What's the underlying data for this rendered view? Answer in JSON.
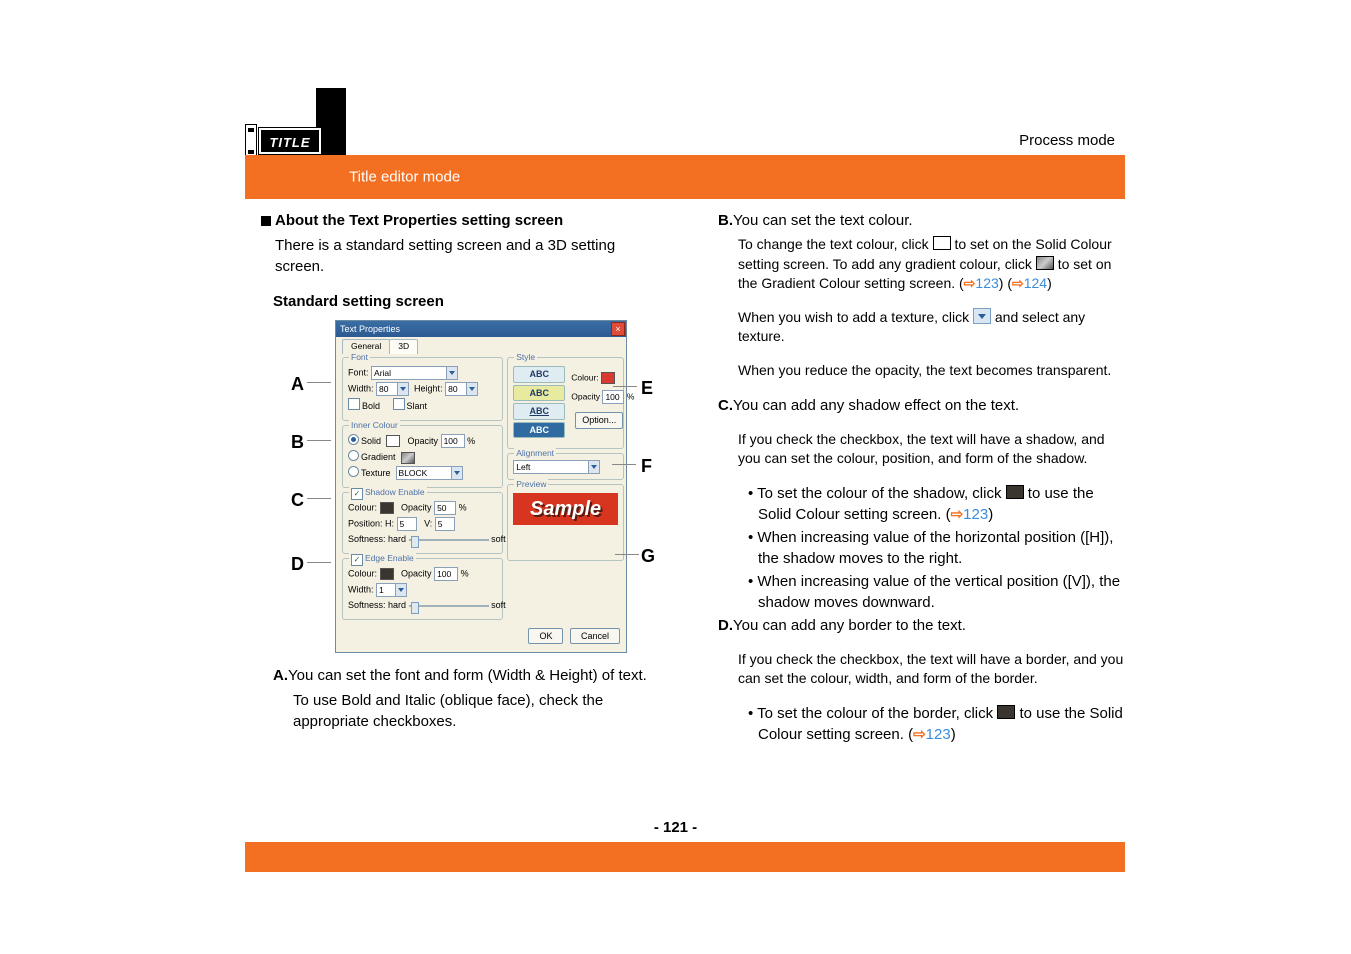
{
  "header": {
    "mode": "Title editor mode",
    "breadcrumb": "Process mode",
    "badge": "TITLE"
  },
  "left": {
    "heading": "About the Text Properties setting screen",
    "intro": "There is a standard setting screen and a 3D setting screen.",
    "subhead": "Standard setting screen",
    "callouts": {
      "a": "A",
      "b": "B",
      "c": "C",
      "d": "D",
      "e": "E",
      "f": "F",
      "g": "G"
    },
    "dialog": {
      "title": "Text Properties",
      "tabs": {
        "general": "General",
        "three_d": "3D"
      },
      "groups": {
        "font": "Font",
        "inner": "Inner Colour",
        "shadow": "Shadow Enable",
        "edge": "Edge Enable",
        "style": "Style",
        "alignment": "Alignment",
        "preview": "Preview"
      },
      "labels": {
        "font": "Font:",
        "width": "Width:",
        "height": "Height:",
        "bold": "Bold",
        "slant": "Slant",
        "solid": "Solid",
        "gradient": "Gradient",
        "texture": "Texture",
        "opacity": "Opacity",
        "colour": "Colour:",
        "position": "Position: H:",
        "v": "V:",
        "softness": "Softness: hard",
        "soft_end": "soft",
        "width2": "Width:",
        "option": "Option..."
      },
      "values": {
        "font_name": "Arial",
        "width": "80",
        "height": "80",
        "opacity": "100",
        "opacity_pct": "%",
        "shadow_opacity": "50",
        "pos_h": "5",
        "pos_v": "5",
        "edge_opacity": "100",
        "edge_width": "1",
        "texture_name": "BLOCK",
        "align": "Left",
        "style_abc": "ABC",
        "style_opacity": "100",
        "sample": "Sample"
      },
      "buttons": {
        "ok": "OK",
        "cancel": "Cancel"
      }
    },
    "items": {
      "a_pre": "A.",
      "a_text": "You can set the font and form (Width & Height) of text.",
      "a_sub": "To use Bold and Italic (oblique face), check the appropriate checkboxes."
    }
  },
  "right": {
    "items": {
      "b_pre": "B.",
      "b_text": "You can set the text colour.",
      "b_line1a": "To change the text colour, click ",
      "b_line1b": " to set on the Solid Colour setting screen. To add any gradient colour, click ",
      "b_line1c": " to set on the Gradient Colour setting screen. (",
      "b_link1": "123",
      "b_mid": ") (",
      "b_link2": "124",
      "b_end1": ")",
      "b_line2a": "When you wish to add a texture, click ",
      "b_line2b": " and select any texture.",
      "b_line3": "When you reduce the opacity, the text becomes transparent.",
      "c_pre": "C.",
      "c_text": "You can add any shadow effect on the text.",
      "c_line1": "If you check the checkbox, the text will have a shadow, and you can set the colour, position, and form of the shadow.",
      "c_bullet1a": "To set the colour of the shadow, click ",
      "c_bullet1b": " to use the Solid Colour setting screen. (",
      "c_bullet1_link": "123",
      "c_bullet1_end": ")",
      "c_bullet2": "When increasing value of the horizontal position ([H]), the shadow moves to the right.",
      "c_bullet3": "When increasing value of the vertical position ([V]), the shadow moves downward.",
      "d_pre": "D.",
      "d_text": "You can add any border to the text.",
      "d_line1": "If you check the checkbox, the text will have a border, and you can set the colour, width, and form of the border.",
      "d_bullet1a": "To set the colour of the border, click ",
      "d_bullet1b": " to use the Solid Colour setting screen. (",
      "d_bullet1_link": "123",
      "d_bullet1_end": ")"
    }
  },
  "page_number": "- 121 -"
}
